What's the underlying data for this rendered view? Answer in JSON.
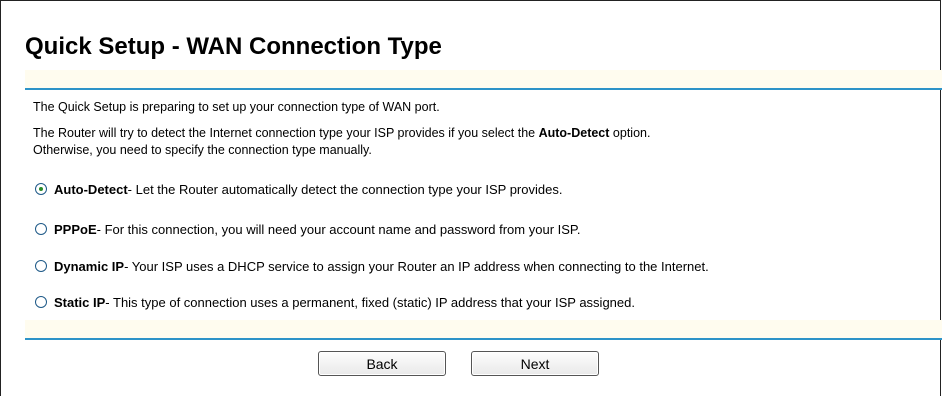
{
  "page": {
    "title": "Quick Setup - WAN Connection Type"
  },
  "intro": {
    "line1": "The Quick Setup is preparing to set up your connection type of WAN port.",
    "line2_before": "The Router will try to detect the Internet connection type your ISP provides if you select the ",
    "line2_bold": "Auto-Detect",
    "line2_after": " option.",
    "line3": "Otherwise, you need to specify the connection type manually."
  },
  "options": [
    {
      "name": "Auto-Detect",
      "description": " - Let the Router automatically detect the connection type your ISP provides.",
      "selected": true
    },
    {
      "name": "PPPoE",
      "description": " - For this connection, you will need your account name and password from your ISP.",
      "selected": false
    },
    {
      "name": "Dynamic IP",
      "description": " - Your ISP uses a DHCP service to assign your Router an IP address when connecting to the Internet.",
      "selected": false
    },
    {
      "name": "Static IP",
      "description": " - This type of connection uses a permanent, fixed (static) IP address that your ISP assigned.",
      "selected": false
    }
  ],
  "buttons": {
    "back_label": "Back",
    "next_label": "Next"
  },
  "colors": {
    "rule": "#2d93c8",
    "band": "#fffcef",
    "radio_dot": "#2a8c2a"
  }
}
